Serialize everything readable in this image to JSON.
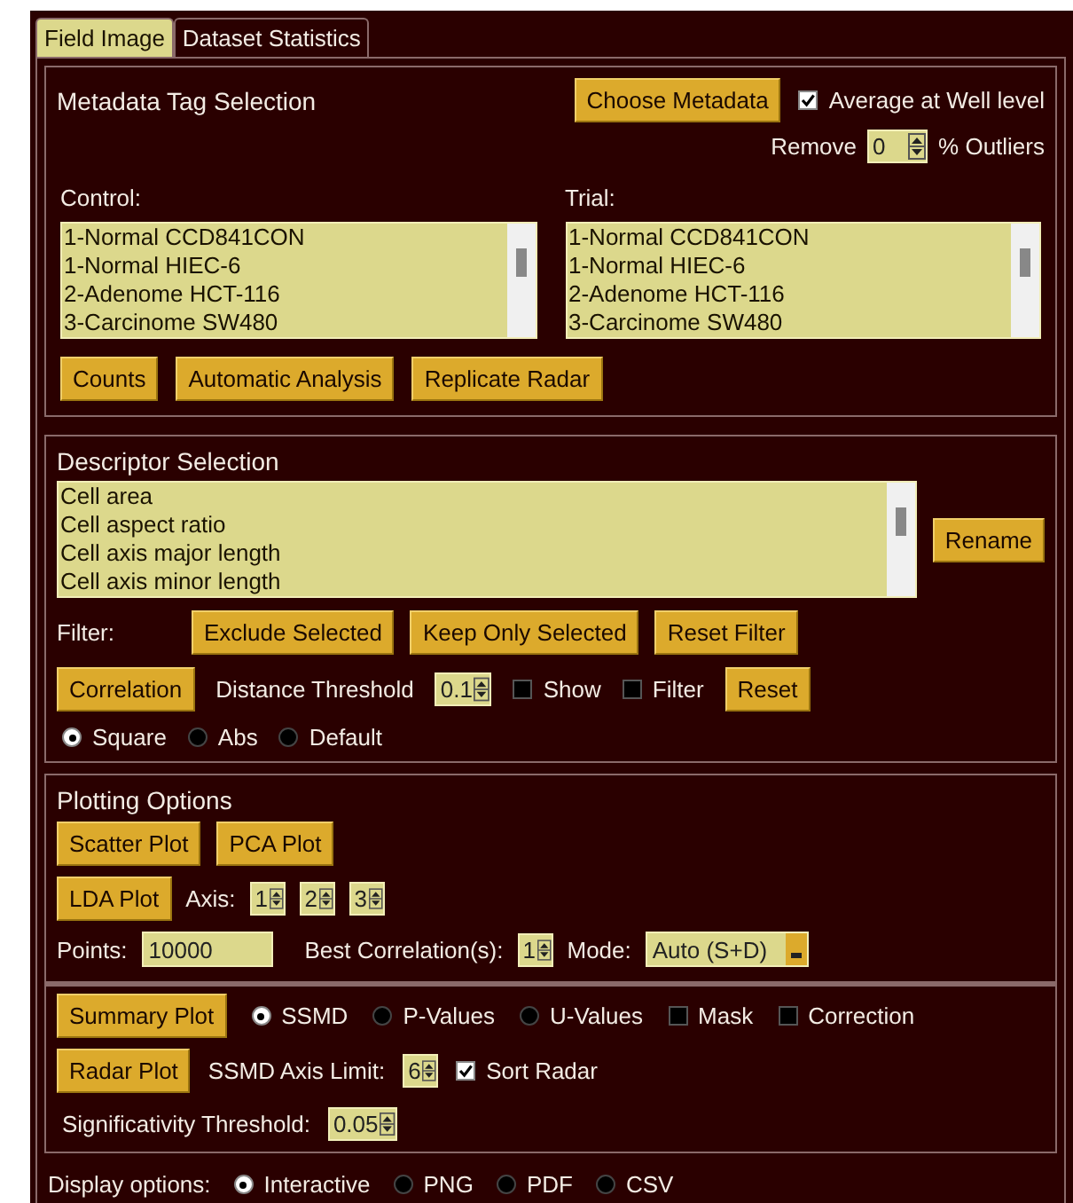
{
  "tabs": [
    {
      "label": "Field Image",
      "selected": true
    },
    {
      "label": "Dataset Statistics",
      "selected": false
    }
  ],
  "metadata": {
    "title": "Metadata Tag Selection",
    "choose_button": "Choose Metadata",
    "average": {
      "label": "Average at Well level",
      "checked": true
    },
    "remove": {
      "label": "Remove",
      "value": "0",
      "suffix": "% Outliers"
    },
    "control": {
      "label": "Control:",
      "items": [
        "1-Normal CCD841CON",
        "1-Normal HIEC-6",
        "2-Adenome HCT-116",
        "3-Carcinome SW480"
      ]
    },
    "trial": {
      "label": "Trial:",
      "items": [
        "1-Normal CCD841CON",
        "1-Normal HIEC-6",
        "2-Adenome HCT-116",
        "3-Carcinome SW480"
      ]
    },
    "buttons": [
      "Counts",
      "Automatic Analysis",
      "Replicate Radar"
    ]
  },
  "descriptor": {
    "title": "Descriptor Selection",
    "items": [
      "Cell area",
      "Cell aspect ratio",
      "Cell axis major length",
      "Cell axis minor length"
    ],
    "rename_button": "Rename",
    "filter_label": "Filter:",
    "filter_buttons": [
      "Exclude Selected",
      "Keep Only Selected",
      "Reset Filter"
    ],
    "correlation_button": "Correlation",
    "distance": {
      "label": "Distance Threshold",
      "value": "0.1"
    },
    "show": {
      "label": "Show",
      "checked": false
    },
    "filter": {
      "label": "Filter",
      "checked": false
    },
    "reset_button": "Reset",
    "modes": [
      {
        "label": "Square",
        "selected": true
      },
      {
        "label": "Abs",
        "selected": false
      },
      {
        "label": "Default",
        "selected": false
      }
    ]
  },
  "plotting": {
    "title": "Plotting Options",
    "buttons": [
      "Scatter Plot",
      "PCA Plot"
    ],
    "lda_button": "LDA Plot",
    "axis_label": "Axis:",
    "axes": [
      "1",
      "2",
      "3"
    ],
    "points": {
      "label": "Points:",
      "value": "10000"
    },
    "best": {
      "label": "Best Correlation(s):",
      "value": "1"
    },
    "mode": {
      "label": "Mode:",
      "value": "Auto (S+D)"
    }
  },
  "summary": {
    "button": "Summary Plot",
    "stats": [
      {
        "label": "SSMD",
        "selected": true
      },
      {
        "label": "P-Values",
        "selected": false
      },
      {
        "label": "U-Values",
        "selected": false
      }
    ],
    "mask": {
      "label": "Mask",
      "checked": false
    },
    "correction": {
      "label": "Correction",
      "checked": false
    },
    "radar_button": "Radar Plot",
    "axis_limit": {
      "label": "SSMD Axis Limit:",
      "value": "6"
    },
    "sort_radar": {
      "label": "Sort Radar",
      "checked": true
    },
    "threshold": {
      "label": "Significativity Threshold:",
      "value": "0.05"
    }
  },
  "display": {
    "label": "Display options:",
    "options": [
      {
        "label": "Interactive",
        "selected": true
      },
      {
        "label": "PNG",
        "selected": false
      },
      {
        "label": "PDF",
        "selected": false
      },
      {
        "label": "CSV",
        "selected": false
      }
    ]
  }
}
